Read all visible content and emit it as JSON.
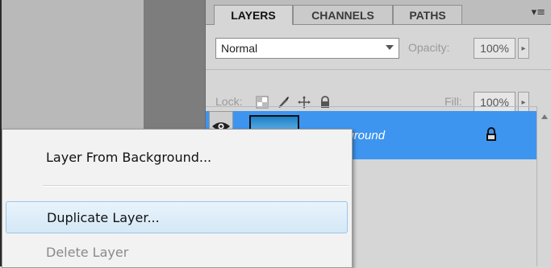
{
  "layers_panel": {
    "tabs": [
      {
        "label": "LAYERS"
      },
      {
        "label": "CHANNELS"
      },
      {
        "label": "PATHS"
      }
    ],
    "panel_menu_glyph": "▾≡",
    "blend_mode": "Normal",
    "opacity_label": "Opacity:",
    "opacity_value": "100%",
    "lock_label": "Lock:",
    "fill_label": "Fill:",
    "fill_value": "100%",
    "layers": [
      {
        "name": "Background",
        "selected": true,
        "locked": true,
        "visible": true
      }
    ]
  },
  "context_menu": {
    "items": [
      {
        "label": "Layer From Background...",
        "state": "normal"
      },
      {
        "label": "Duplicate Layer...",
        "state": "hover"
      },
      {
        "label": "Delete Layer",
        "state": "disabled"
      }
    ]
  },
  "colors": {
    "selection": "#3d95ef",
    "menu_hover_border": "#9cc6e6"
  }
}
